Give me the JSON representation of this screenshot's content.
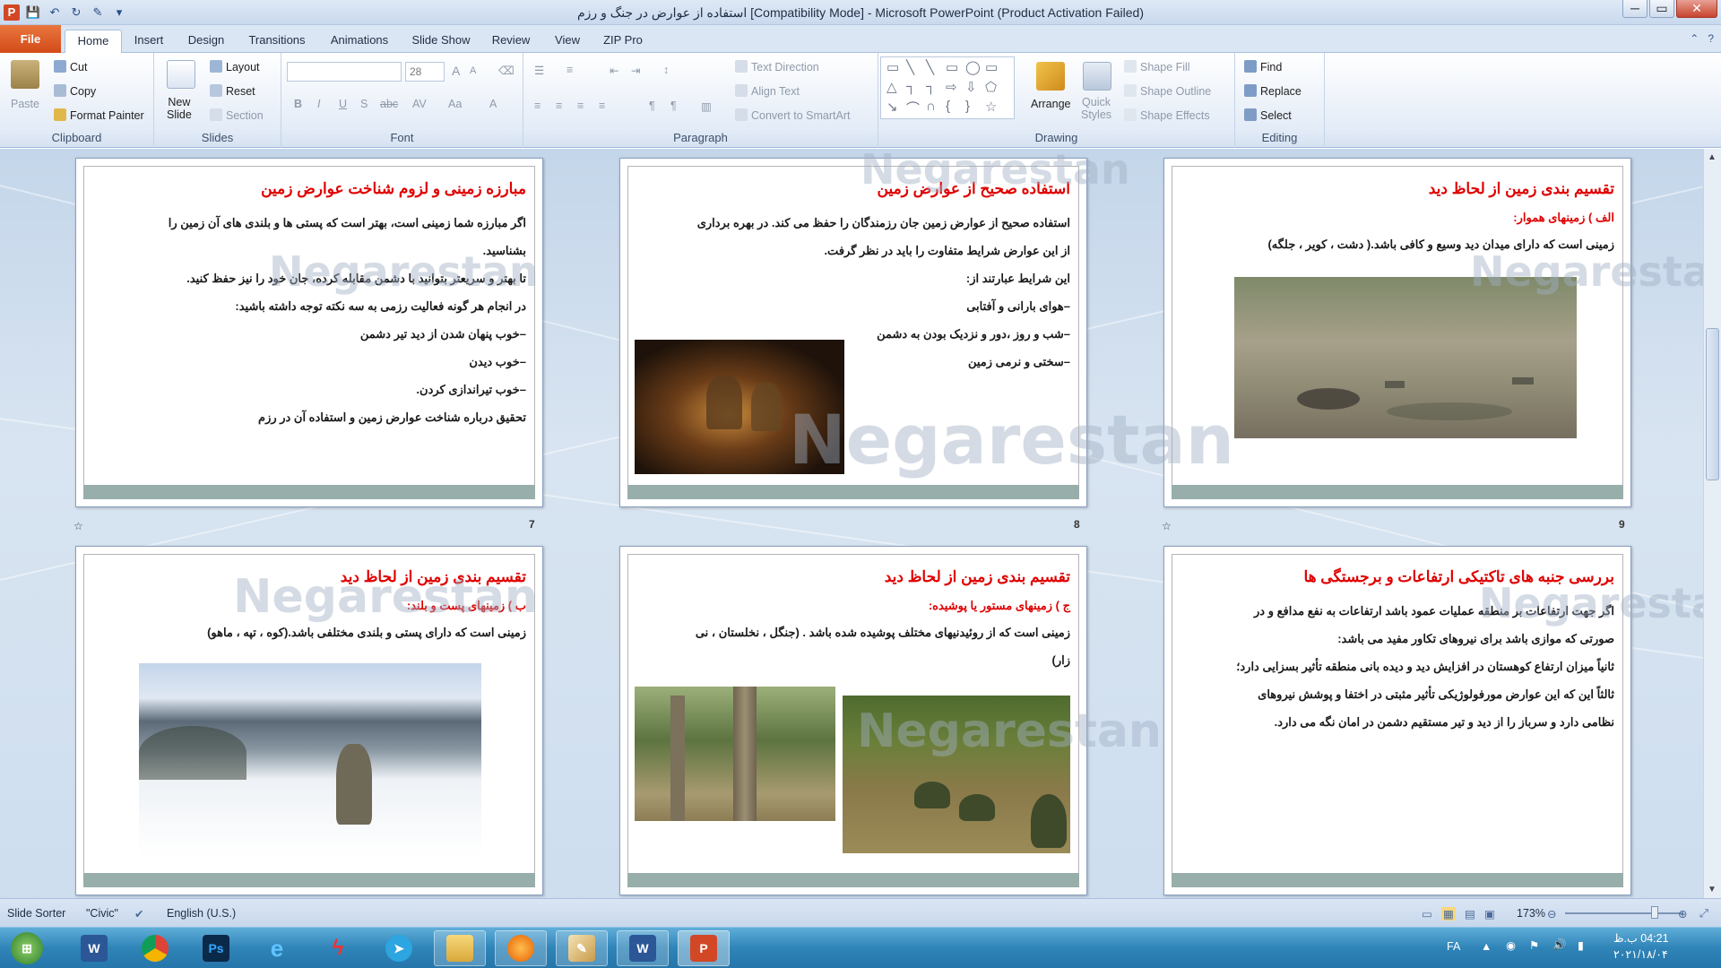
{
  "window": {
    "title": "استفاده از عوارض در جنگ و رزم [Compatibility Mode] - Microsoft PowerPoint (Product Activation Failed)",
    "controls": {
      "minimize": "─",
      "maximize": "▭",
      "close": "✕"
    }
  },
  "qat": {
    "app_icon": "P",
    "save": "💾",
    "undo": "↶",
    "redo": "↻",
    "repeat": "✎",
    "customize": "▾"
  },
  "tabs": {
    "file": "File",
    "items": [
      "Home",
      "Insert",
      "Design",
      "Transitions",
      "Animations",
      "Slide Show",
      "Review",
      "View",
      "ZIP Pro"
    ],
    "active": "Home",
    "right_icons": {
      "collapse": "⌃",
      "help": "?"
    }
  },
  "ribbon": {
    "clipboard": {
      "label": "Clipboard",
      "paste": "Paste",
      "cut": "Cut",
      "copy": "Copy",
      "format_painter": "Format Painter"
    },
    "slides": {
      "label": "Slides",
      "new_slide_1": "New",
      "new_slide_2": "Slide",
      "layout": "Layout",
      "reset": "Reset",
      "section": "Section"
    },
    "font": {
      "label": "Font",
      "font_name": "",
      "font_size": "28"
    },
    "paragraph": {
      "label": "Paragraph",
      "text_direction": "Text Direction",
      "align_text": "Align Text",
      "convert_smartart": "Convert to SmartArt"
    },
    "drawing": {
      "label": "Drawing",
      "arrange": "Arrange",
      "quick_styles_1": "Quick",
      "quick_styles_2": "Styles",
      "shape_fill": "Shape Fill",
      "shape_outline": "Shape Outline",
      "shape_effects": "Shape Effects"
    },
    "editing": {
      "label": "Editing",
      "find": "Find",
      "replace": "Replace",
      "select": "Select"
    }
  },
  "watermark": "Negarestan",
  "slides": [
    {
      "number": "7",
      "title": "مبارزه زمینی و لزوم شناخت عوارض زمین",
      "subtitle": "",
      "body": [
        "اگر مبارزه شما زمینی است، بهتر است که پستی ها و بلندی های آن زمین را",
        "بشناسید.",
        "تا بهتر و سریعتر بتوانید با دشمن مقابله کرده، جان خود را نیز حفظ کنید.",
        "در انجام هر گونه فعالیت رزمی به سه نکته توجه داشته باشید:",
        "–خوب پنهان شدن از دید تیر دشمن",
        "–خوب دیدن",
        "–خوب تیراندازی کردن.",
        "تحقیق درباره شناخت عوارض زمین و استفاده آن در رزم"
      ]
    },
    {
      "number": "8",
      "title": "استفاده صحیح از عوارض زمین",
      "subtitle": "",
      "body": [
        "استفاده صحیح از عوارض زمین جان رزمندگان را حفظ می کند. در بهره برداری",
        "از این عوارض شرایط متفاوت را باید در نظر گرفت.",
        "این شرایط عبارتند از:",
        "–هوای بارانی و آفتابی",
        "–شب و روز ،دور و نزدیک بودن به دشمن",
        "–سختی و نرمی زمین"
      ]
    },
    {
      "number": "9",
      "title": "تقسیم بندی زمین از لحاظ دید",
      "subtitle": "الف ) زمینهای هموار:",
      "body": [
        "زمینی است که دارای میدان دید وسیع و کافی باشد.( دشت ، کویر ، جلگه)"
      ]
    },
    {
      "number": "",
      "title": "تقسیم بندی زمین از لحاظ دید",
      "subtitle": "ب ) زمینهای پست و بلند:",
      "body": [
        "زمینی است که دارای پستی و بلندی مختلفی باشد.(کوه ، تپه ، ماهو)"
      ]
    },
    {
      "number": "",
      "title": "تقسیم بندی زمین از لحاظ دید",
      "subtitle": "ج ) زمینهای مستور یا پوشیده:",
      "body": [
        "زمینی است که از روئیدنیهای مختلف پوشیده شده باشد . (جنگل ، نخلستان ، نی",
        "زار)"
      ]
    },
    {
      "number": "",
      "title": "بررسی جنبه های تاکتیکی ارتفاعات و برجستگی ها",
      "subtitle": "",
      "body": [
        "اگر جهت ارتفاعات بر منطقه عملیات عمود باشد ارتفاعات به نفع مدافع و در",
        "صورتی که موازی باشد برای نیروهای تکاور مفید می باشد:",
        "ثانیاً میزان ارتفاع کوهستان در افزایش دید و دیده بانی منطقه تأثیر بسزایی دارد؛",
        "ثالثاً این که این عوارض مورفولوژیکی تأثیر مثبتی در اختفا و پوشش نیروهای",
        "نظامی دارد و سرباز را از دید و تیر مستقیم دشمن در امان نگه می دارد."
      ]
    }
  ],
  "status": {
    "view": "Slide Sorter",
    "theme": "\"Civic\"",
    "language": "English (U.S.)",
    "zoom": "173%"
  },
  "taskbar": {
    "apps": [
      "Word",
      "Chrome",
      "Photoshop",
      "Internet Explorer",
      "Flash",
      "Telegram",
      "Explorer",
      "Firefox",
      "Paint",
      "Word",
      "PowerPoint"
    ],
    "lang": "FA",
    "time": "04:21 ب.ظ",
    "date": "۲۰۲۱/۱۸/۰۴"
  }
}
